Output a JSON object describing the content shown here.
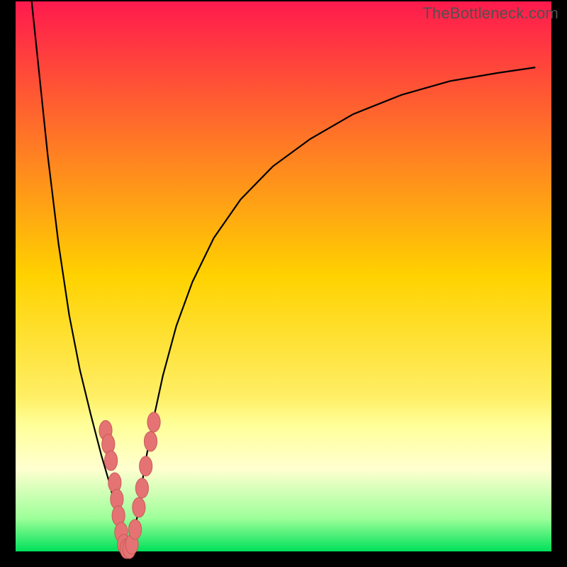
{
  "watermark": "TheBottleneck.com",
  "chart_data": {
    "type": "line",
    "title": "",
    "xlabel": "",
    "ylabel": "",
    "xlim": [
      0,
      100
    ],
    "ylim": [
      0,
      100
    ],
    "background_gradient": [
      {
        "stop": 0.0,
        "color": "#ff1a4d"
      },
      {
        "stop": 0.5,
        "color": "#ffd200"
      },
      {
        "stop": 0.72,
        "color": "#ffef66"
      },
      {
        "stop": 0.77,
        "color": "#ffff99"
      },
      {
        "stop": 0.85,
        "color": "#ffffd0"
      },
      {
        "stop": 0.94,
        "color": "#9dff99"
      },
      {
        "stop": 1.0,
        "color": "#00e05a"
      }
    ],
    "frame_color": "#000000",
    "series": [
      {
        "name": "curve-left",
        "stroke": "#000000",
        "x": [
          3.0,
          4.5,
          6.0,
          8.0,
          10.0,
          12.0,
          14.0,
          16.0,
          17.5,
          18.5,
          19.2,
          19.8,
          20.3,
          20.8
        ],
        "y": [
          100.0,
          86.0,
          72.0,
          56.0,
          43.0,
          33.0,
          25.0,
          17.5,
          12.5,
          8.5,
          5.5,
          3.0,
          1.2,
          0.1
        ]
      },
      {
        "name": "curve-right",
        "stroke": "#000000",
        "x": [
          21.5,
          22.0,
          23.0,
          24.0,
          25.5,
          27.5,
          30.0,
          33.0,
          37.0,
          42.0,
          48.0,
          55.0,
          63.0,
          72.0,
          81.0,
          90.0,
          97.0
        ],
        "y": [
          0.1,
          2.5,
          8.0,
          15.0,
          23.0,
          32.0,
          41.0,
          49.0,
          57.0,
          64.0,
          70.0,
          75.0,
          79.5,
          83.0,
          85.5,
          87.0,
          88.0
        ]
      }
    ],
    "markers": {
      "color": "#e57373",
      "stroke": "#c85a5a",
      "rx": 1.2,
      "ry": 1.8,
      "points": [
        {
          "x": 16.8,
          "y": 22.0
        },
        {
          "x": 17.3,
          "y": 19.5
        },
        {
          "x": 17.8,
          "y": 16.5
        },
        {
          "x": 18.5,
          "y": 12.5
        },
        {
          "x": 18.9,
          "y": 9.5
        },
        {
          "x": 19.2,
          "y": 6.5
        },
        {
          "x": 19.7,
          "y": 3.5
        },
        {
          "x": 20.2,
          "y": 1.3
        },
        {
          "x": 20.7,
          "y": 0.5
        },
        {
          "x": 21.2,
          "y": 0.5
        },
        {
          "x": 21.7,
          "y": 1.3
        },
        {
          "x": 22.3,
          "y": 4.0
        },
        {
          "x": 23.0,
          "y": 8.0
        },
        {
          "x": 23.6,
          "y": 11.5
        },
        {
          "x": 24.3,
          "y": 15.5
        },
        {
          "x": 25.2,
          "y": 20.0
        },
        {
          "x": 25.8,
          "y": 23.5
        }
      ]
    }
  }
}
